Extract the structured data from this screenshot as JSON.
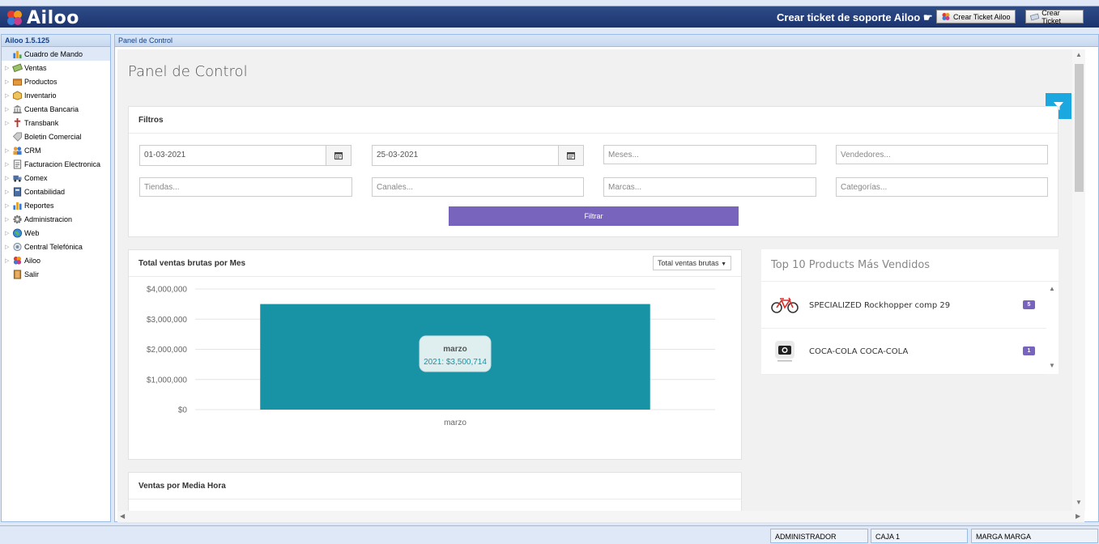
{
  "app": {
    "logo_text": "Ailoo",
    "support_text": "Crear ticket de soporte Ailoo ☛",
    "btn_ticket_ailoo": "Crear Ticket Ailoo",
    "btn_ticket": "Crear Ticket"
  },
  "sidebar": {
    "version": "Ailoo 1.5.125",
    "items": [
      {
        "label": "Cuadro de Mando",
        "icon": "chart-icon",
        "selected": true,
        "expandable": false
      },
      {
        "label": "Ventas",
        "icon": "money-icon",
        "expandable": true
      },
      {
        "label": "Productos",
        "icon": "box-icon",
        "expandable": true
      },
      {
        "label": "Inventario",
        "icon": "package-icon",
        "expandable": true
      },
      {
        "label": "Cuenta Bancaria",
        "icon": "bank-icon",
        "expandable": true
      },
      {
        "label": "Transbank",
        "icon": "cross-icon",
        "expandable": true
      },
      {
        "label": "Boletin Comercial",
        "icon": "tag-icon",
        "expandable": false
      },
      {
        "label": "CRM",
        "icon": "people-icon",
        "expandable": true
      },
      {
        "label": "Facturacion Electronica",
        "icon": "document-icon",
        "expandable": true
      },
      {
        "label": "Comex",
        "icon": "truck-icon",
        "expandable": true
      },
      {
        "label": "Contabilidad",
        "icon": "ledger-icon",
        "expandable": true
      },
      {
        "label": "Reportes",
        "icon": "report-icon",
        "expandable": true
      },
      {
        "label": "Administracion",
        "icon": "gear-icon",
        "expandable": true
      },
      {
        "label": "Web",
        "icon": "globe-icon",
        "expandable": true
      },
      {
        "label": "Central Telefónica",
        "icon": "phone-icon",
        "expandable": true
      },
      {
        "label": "Ailoo",
        "icon": "ailoo-logo-icon",
        "expandable": true
      },
      {
        "label": "Salir",
        "icon": "exit-icon",
        "expandable": false
      }
    ]
  },
  "main": {
    "tab_label": "Panel de Control",
    "page_title": "Panel de Control"
  },
  "filters": {
    "title": "Filtros",
    "date_from": "01-03-2021",
    "date_to": "25-03-2021",
    "meses_placeholder": "Meses...",
    "vendedores_placeholder": "Vendedores...",
    "tiendas_placeholder": "Tiendas...",
    "canales_placeholder": "Canales...",
    "marcas_placeholder": "Marcas...",
    "categorias_placeholder": "Categorías...",
    "filtrar_label": "Filtrar"
  },
  "sales_chart": {
    "title": "Total ventas brutas por Mes",
    "dropdown_value": "Total ventas brutas",
    "tooltip_title": "marzo",
    "tooltip_value": "2021: $3,500,714"
  },
  "chart_data": {
    "type": "bar",
    "categories": [
      "marzo"
    ],
    "series": [
      {
        "name": "2021",
        "values": [
          3500714
        ]
      }
    ],
    "ylim": [
      0,
      4000000
    ],
    "yticks": [
      "$0",
      "$1,000,000",
      "$2,000,000",
      "$3,000,000",
      "$4,000,000"
    ],
    "color": "#1793a5",
    "grid": true
  },
  "top10": {
    "title": "Top 10 Products Más Vendidos",
    "products": [
      {
        "name": "SPECIALIZED Rockhopper comp 29",
        "count": "5",
        "icon": "bicycle-icon"
      },
      {
        "name": "COCA-COLA COCA-COLA",
        "count": "1",
        "icon": "camera-placeholder-icon"
      }
    ]
  },
  "half_hour": {
    "title": "Ventas por Media Hora"
  },
  "status": {
    "user": "ADMINISTRADOR",
    "register": "CAJA 1",
    "brand": "MARGA MARGA"
  }
}
